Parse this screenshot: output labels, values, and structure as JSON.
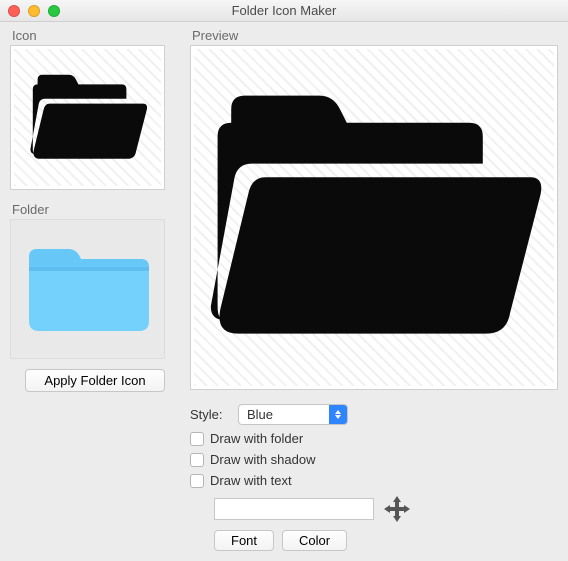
{
  "window": {
    "title": "Folder Icon Maker"
  },
  "left": {
    "icon_label": "Icon",
    "folder_label": "Folder",
    "apply_button": "Apply Folder Icon"
  },
  "right": {
    "preview_label": "Preview"
  },
  "controls": {
    "style_label": "Style:",
    "style_selected": "Blue",
    "draw_with_folder": "Draw with folder",
    "draw_with_shadow": "Draw with shadow",
    "draw_with_text": "Draw with text",
    "text_value": "",
    "font_button": "Font",
    "color_button": "Color"
  }
}
